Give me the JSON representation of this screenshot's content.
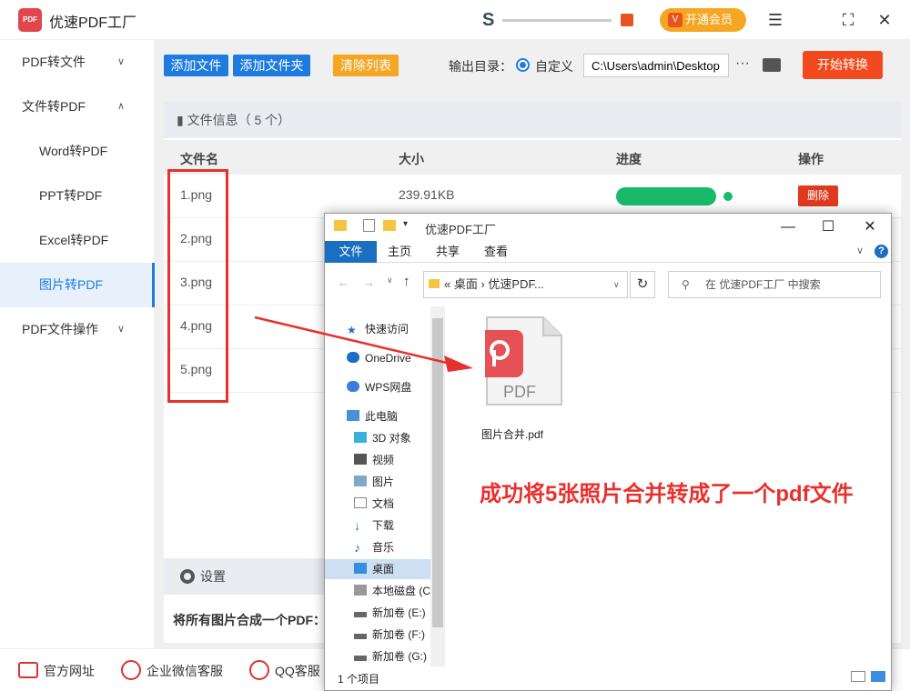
{
  "app": {
    "title": "优速PDF工厂",
    "logo_text": "PDF",
    "vip": "开通会员"
  },
  "sidebar": {
    "items": [
      {
        "label": "PDF转文件"
      },
      {
        "label": "文件转PDF"
      },
      {
        "label": "Word转PDF"
      },
      {
        "label": "PPT转PDF"
      },
      {
        "label": "Excel转PDF"
      },
      {
        "label": "图片转PDF"
      },
      {
        "label": "PDF文件操作"
      }
    ]
  },
  "toolbar": {
    "add_file": "添加文件",
    "add_folder": "添加文件夹",
    "clear": "清除列表",
    "output_label": "输出目录：",
    "radio_label": "自定义",
    "path": "C:\\Users\\admin\\Desktop",
    "dots": "···",
    "start": "开始转换"
  },
  "panel": {
    "title": "文件信息（ 5 个）",
    "columns": [
      "文件名",
      "大小",
      "进度",
      "操作"
    ],
    "files": [
      {
        "name": "1.png",
        "size": "239.91KB"
      },
      {
        "name": "2.png"
      },
      {
        "name": "3.png"
      },
      {
        "name": "4.png"
      },
      {
        "name": "5.png"
      }
    ],
    "progress_row1": 1.0,
    "delete": "删除"
  },
  "settings": {
    "title": "设置",
    "merge_label": "将所有图片合成一个PDF："
  },
  "footer": {
    "items": [
      "官方网址",
      "企业微信客服",
      "QQ客服"
    ]
  },
  "explorer": {
    "title": "优速PDF工厂",
    "tabs": [
      "文件",
      "主页",
      "共享",
      "查看"
    ],
    "address": "«  桌面  ›  优速PDF...",
    "search": "在 优速PDF工厂 中搜索",
    "nav": [
      "快速访问",
      "OneDrive",
      "WPS网盘",
      "此电脑",
      "3D 对象",
      "视频",
      "图片",
      "文档",
      "下载",
      "音乐",
      "桌面",
      "本地磁盘 (C",
      "新加卷 (E:)",
      "新加卷 (F:)",
      "新加卷 (G:)"
    ],
    "file_name": "图片合并.pdf",
    "pdf_label": "PDF",
    "status": "1 个项目"
  },
  "annotation": "成功将5张照片合并转成了一个pdf文件",
  "colors": {
    "accent": "#1e7be0",
    "start": "#f2491e",
    "progress": "#19b96b",
    "annotation": "#e8312c",
    "clear": "#f5a623"
  }
}
